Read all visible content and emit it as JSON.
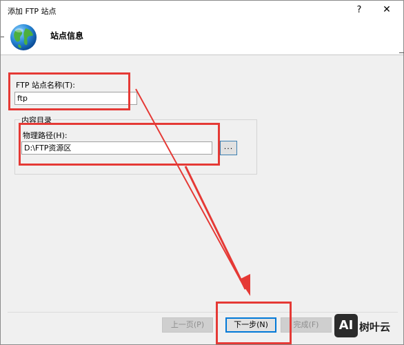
{
  "window": {
    "title": "添加 FTP 站点",
    "help_glyph": "?",
    "close_glyph": "✕"
  },
  "header": {
    "title": "站点信息",
    "icon": "globe-icon"
  },
  "form": {
    "site_name_label": "FTP 站点名称(T):",
    "site_name_value": "ftp",
    "group_title": "内容目录",
    "physical_path_label": "物理路径(H):",
    "physical_path_value": "D:\\FTP资源区",
    "browse_label": "..."
  },
  "buttons": {
    "previous": "上一页(P)",
    "next": "下一步(N)",
    "finish": "完成(F)"
  },
  "watermark": {
    "logo": "AI",
    "text": "树叶云"
  },
  "colors": {
    "annotation_red": "#e53935",
    "accent_blue": "#0078d7"
  }
}
